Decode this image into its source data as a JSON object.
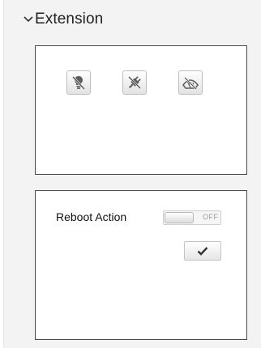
{
  "section": {
    "title": "Extension",
    "expanded": true
  },
  "icons": [
    {
      "name": "lamp-off-icon"
    },
    {
      "name": "plug-off-icon"
    },
    {
      "name": "wiper-off-icon"
    }
  ],
  "reboot": {
    "label": "Reboot Action",
    "toggle_state": "OFF",
    "apply_icon": "checkmark-icon"
  },
  "colors": {
    "panel": "#f3f3f3",
    "card_border": "#4a4a4a",
    "toggle_text": "#9a9a9a"
  }
}
